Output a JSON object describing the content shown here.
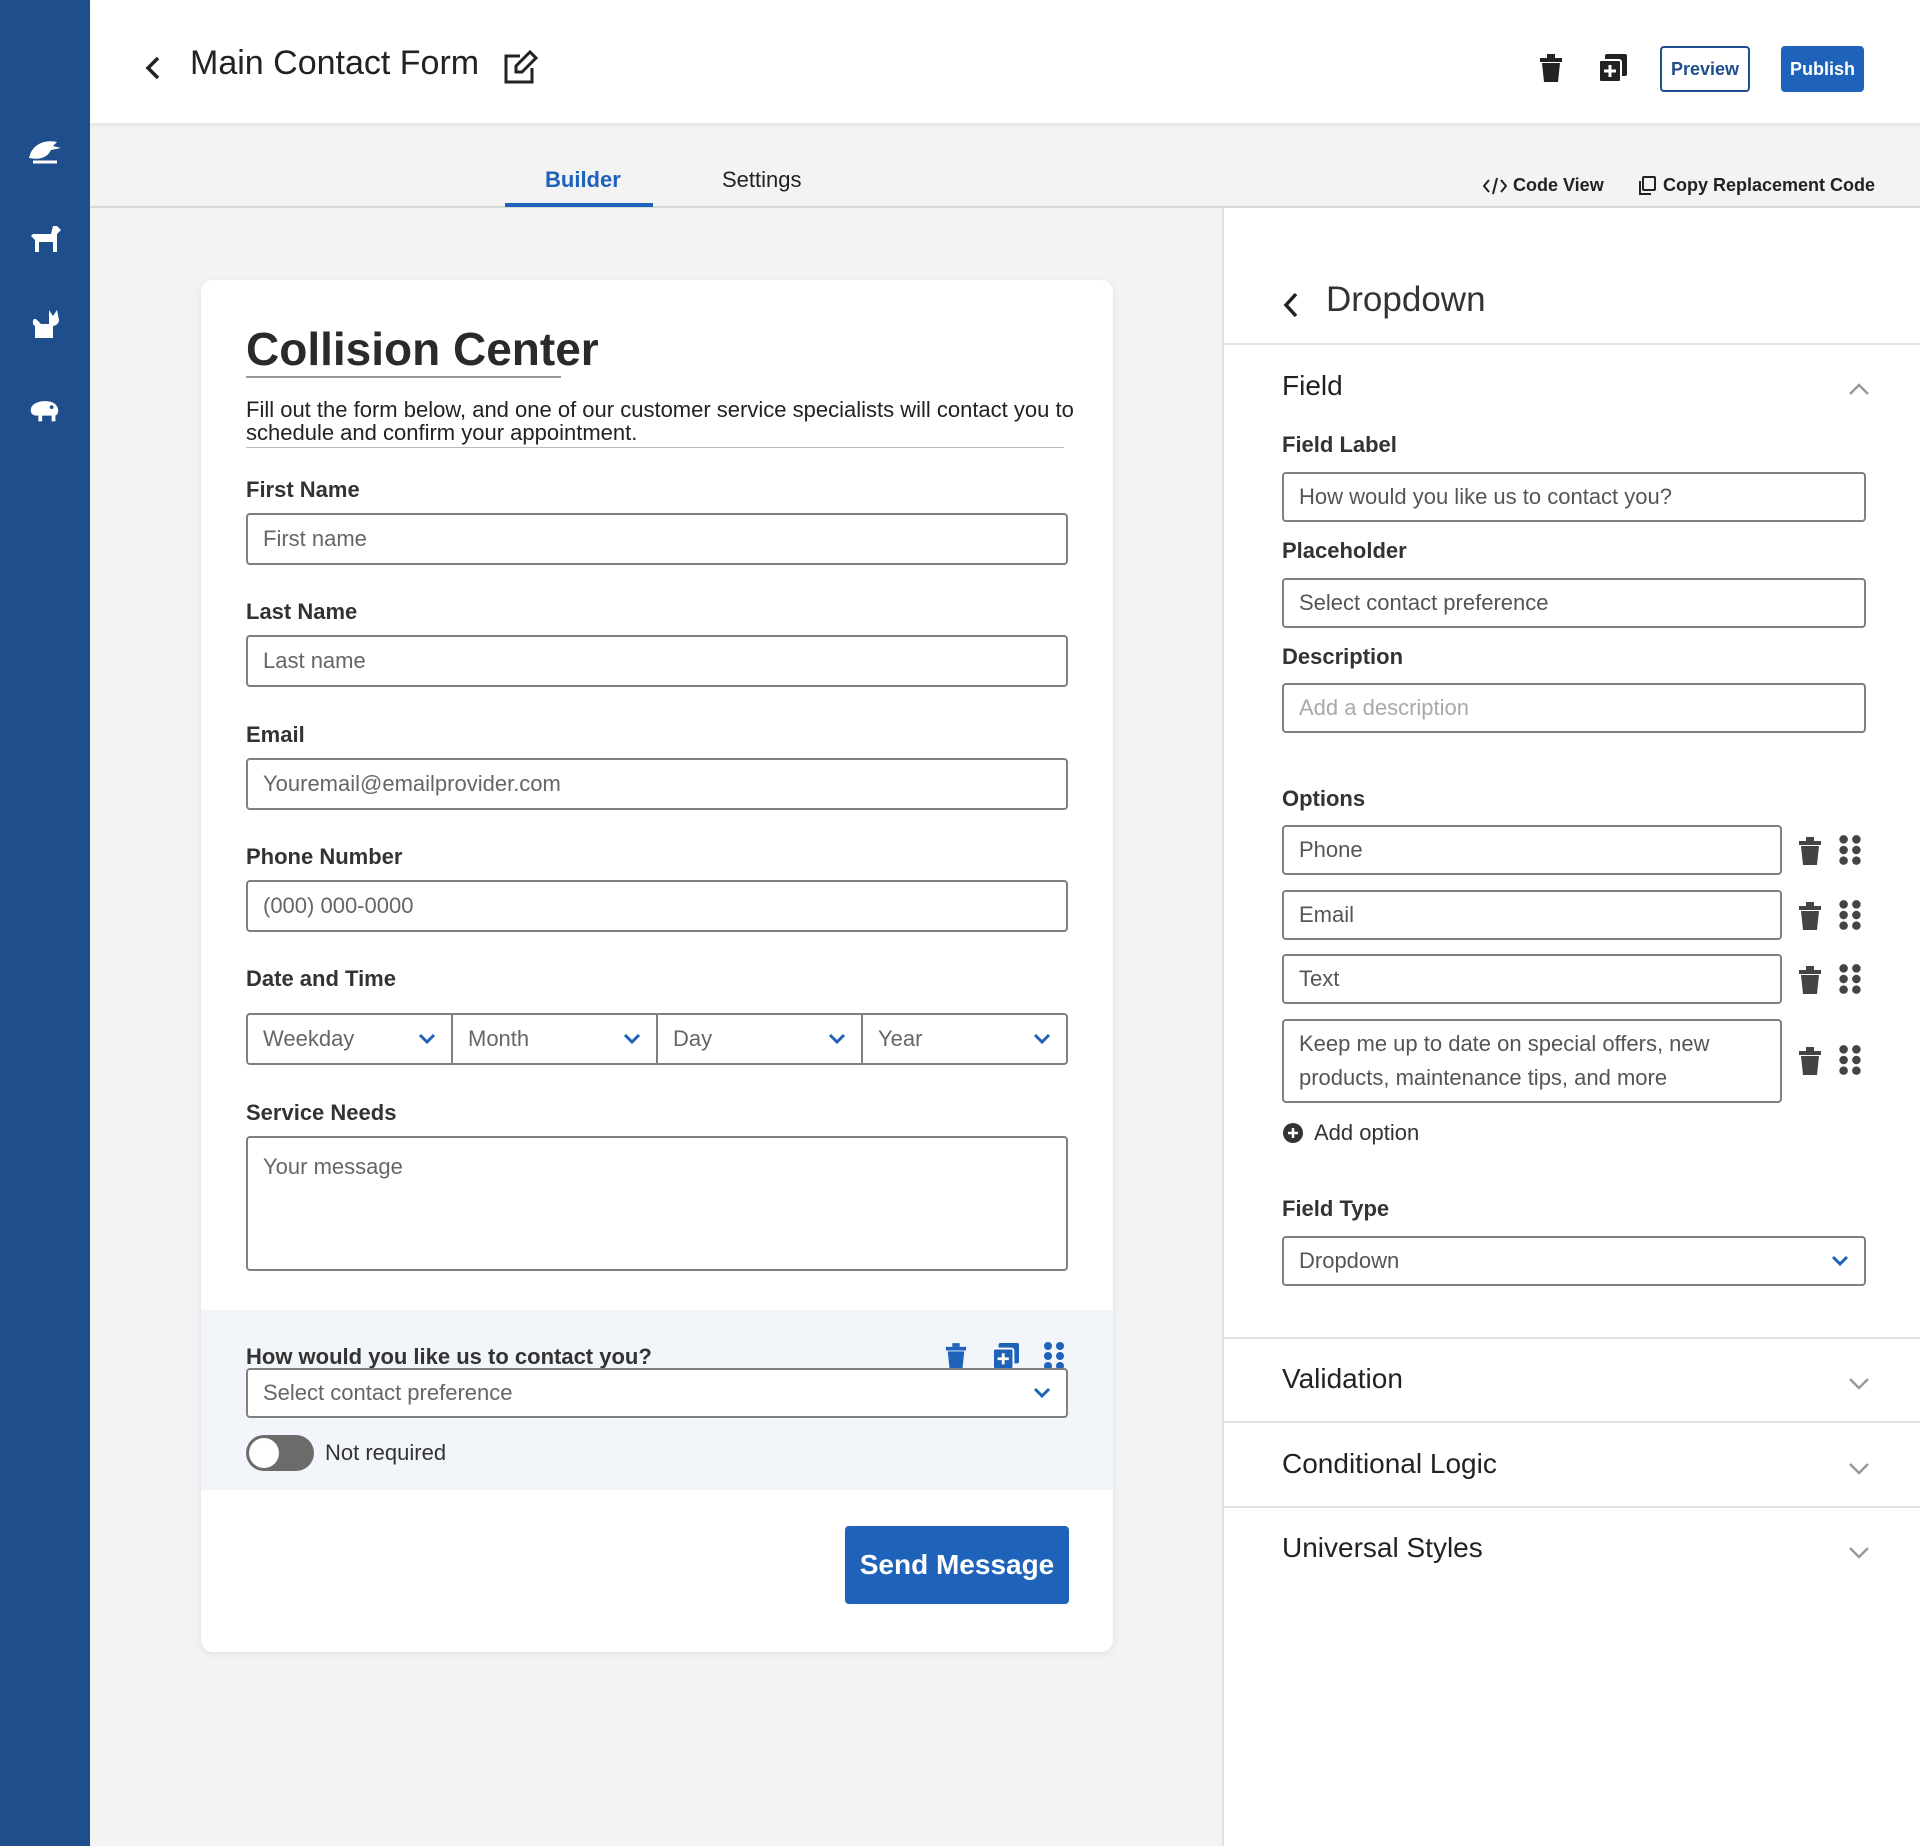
{
  "header": {
    "title": "Main Contact Form",
    "preview_label": "Preview",
    "publish_label": "Publish"
  },
  "tabs": {
    "builder": "Builder",
    "settings": "Settings",
    "code_view": "Code View",
    "copy_code": "Copy Replacement Code"
  },
  "form": {
    "title": "Collision Center",
    "description": "Fill out the form below, and one of our customer service specialists will contact you to schedule and confirm your appointment.",
    "first_name": {
      "label": "First Name",
      "placeholder": "First name"
    },
    "last_name": {
      "label": "Last Name",
      "placeholder": "Last name"
    },
    "email": {
      "label": "Email",
      "placeholder": "Youremail@emailprovider.com"
    },
    "phone": {
      "label": "Phone Number",
      "placeholder": "(000) 000-0000"
    },
    "datetime": {
      "label": "Date and Time",
      "selects": [
        "Weekday",
        "Month",
        "Day",
        "Year"
      ]
    },
    "service": {
      "label": "Service Needs",
      "placeholder": "Your message"
    },
    "contact": {
      "label": "How would you like us to contact you?",
      "placeholder": "Select contact preference",
      "required_label": "Not required",
      "required": false
    },
    "submit_label": "Send Message"
  },
  "panel": {
    "title": "Dropdown",
    "field_section": "Field",
    "field_label_title": "Field Label",
    "field_label_value": "How would you like us to contact you?",
    "placeholder_title": "Placeholder",
    "placeholder_value": "Select contact preference",
    "description_title": "Description",
    "description_placeholder": "Add a description",
    "options_title": "Options",
    "options": [
      "Phone",
      "Email",
      "Text",
      "Keep me up to date on special offers, new products, maintenance tips, and more"
    ],
    "add_option": "Add option",
    "field_type_title": "Field Type",
    "field_type_value": "Dropdown",
    "validation": "Validation",
    "conditional_logic": "Conditional Logic",
    "universal_styles": "Universal Styles"
  },
  "colors": {
    "rail": "#1f4e8c",
    "accent": "#1f62b9"
  }
}
